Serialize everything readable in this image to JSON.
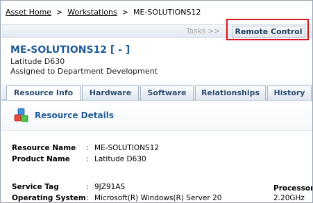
{
  "breadcrumb": {
    "home": "Asset Home",
    "sep1": ">",
    "workstations": "Workstations",
    "sep2": ">",
    "current": "ME-SOLUTIONS12"
  },
  "action_bar": {
    "tasks_label": "Tasks >>",
    "remote_control_label": "Remote Control",
    "highlight_color": "#d9141c"
  },
  "resource": {
    "title": "ME-SOLUTIONS12 [ - ]",
    "model": "Latitude D630",
    "assignment": "Assigned to Department Development"
  },
  "tabs": [
    {
      "label": "Resource Info",
      "active": true
    },
    {
      "label": "Hardware",
      "active": false
    },
    {
      "label": "Software",
      "active": false
    },
    {
      "label": "Relationships",
      "active": false
    },
    {
      "label": "History",
      "active": false
    }
  ],
  "section": {
    "title": "Resource Details",
    "icon": "cubes-icon"
  },
  "details": [
    {
      "label": "Resource Name",
      "colon": ":",
      "value": "ME-SOLUTIONS12"
    },
    {
      "label": "Product Name",
      "colon": ":",
      "value": "Latitude D630"
    },
    {
      "label": "Service Tag",
      "colon": ":",
      "value": "9JZ91AS"
    },
    {
      "label": "Operating System",
      "colon": ":",
      "value": "Microsoft(R) Windows(R) Server 20"
    }
  ],
  "side": {
    "label": "Processor",
    "value": "2.20GHz"
  },
  "colors": {
    "accent_blue": "#1f5a96",
    "tab_text": "#2b4d6f"
  }
}
